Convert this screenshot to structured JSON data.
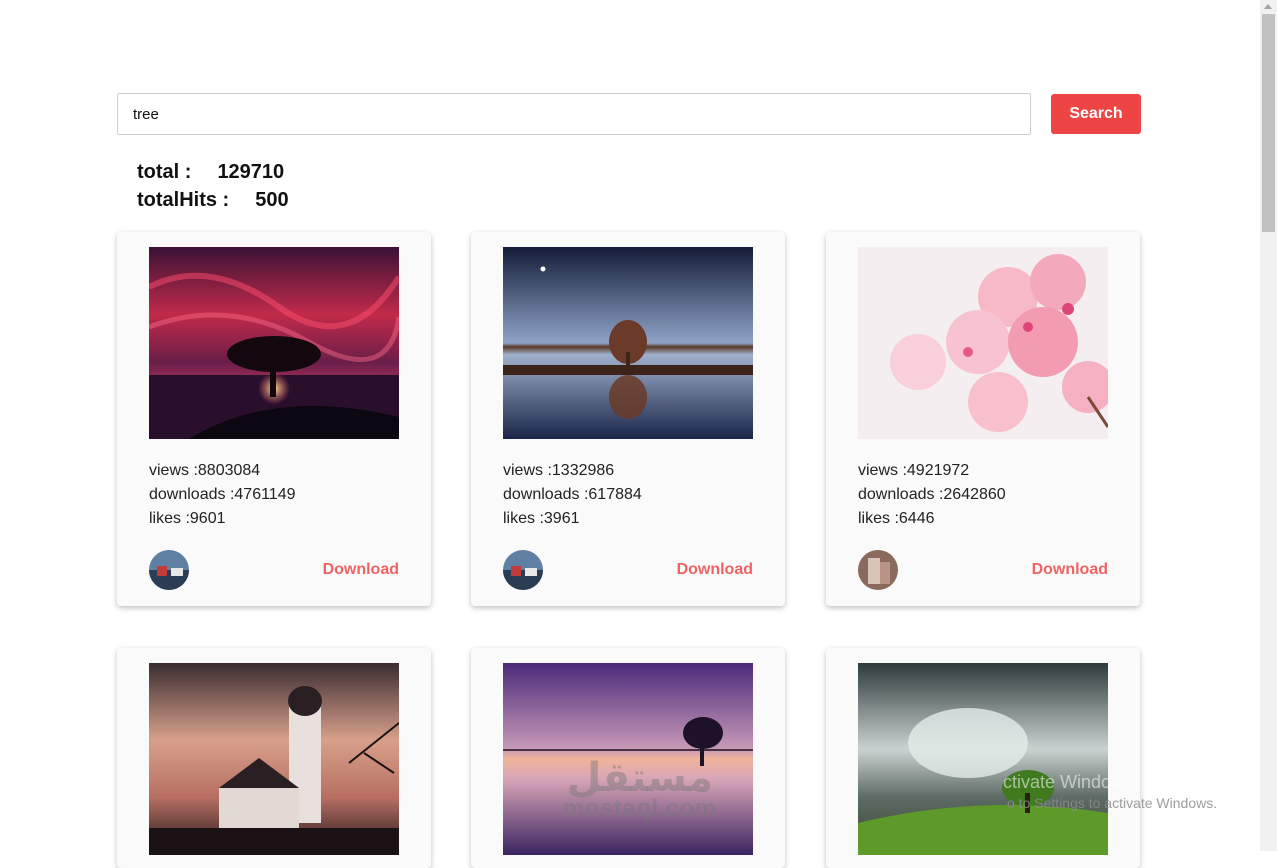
{
  "search": {
    "value": "tree",
    "placeholder": "",
    "button_label": "Search"
  },
  "stats": {
    "total_label": "total :",
    "total_value": "129710",
    "hits_label": "totalHits :",
    "hits_value": "500"
  },
  "cards": [
    {
      "views": "views :8803084",
      "downloads": "downloads :4761149",
      "likes": "likes :9601",
      "download_label": "Download",
      "photo": "sunset-tree-photo"
    },
    {
      "views": "views :1332986",
      "downloads": "downloads :617884",
      "likes": "likes :3961",
      "download_label": "Download",
      "photo": "lake-tree-reflection-photo"
    },
    {
      "views": "views :4921972",
      "downloads": "downloads :2642860",
      "likes": "likes :6446",
      "download_label": "Download",
      "photo": "cherry-blossom-photo"
    },
    {
      "photo": "church-tower-sunset-photo"
    },
    {
      "photo": "purple-lake-tree-photo"
    },
    {
      "photo": "green-tree-clouds-photo"
    }
  ],
  "overlays": {
    "watermark_arabic": "مستقل",
    "watermark_text": "mostaql.com",
    "activation_line1": "ctivate Windows",
    "activation_line2": "o to Settings to activate Windows."
  }
}
